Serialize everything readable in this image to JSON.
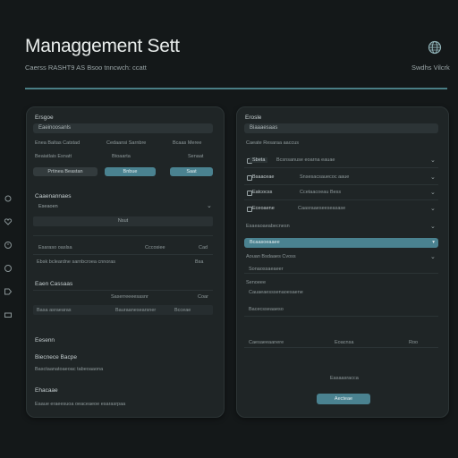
{
  "header": {
    "title": "Managgement Sett",
    "subtitle": "Caerss RASHT9 AS Bsoo tnncwch: ccatt",
    "top_right": "Swdhs Vilcrk"
  },
  "left_panel": {
    "section1": {
      "label": "Ersgoe",
      "field_value": "Eaeinoosanls",
      "col_labels": [
        "Enea Baltas Catstad",
        "Cedaansi Sarnbre",
        "Bcaas Meree"
      ],
      "row_values": [
        "Beaiatlais Esnatt",
        "Btoaarta",
        "Senaat"
      ],
      "buttons": [
        "Prtinea Beastan",
        "Bnbue",
        "Saat"
      ]
    },
    "section2": {
      "label": "Caaenannaes",
      "dropdown_value": "Eseaoen",
      "bar_text": "Nsut",
      "row1_left": "Esaraso oaslsa",
      "row1_mid": "Cccosiee",
      "row1_right": "Cad",
      "row2_left": "Ebsk bcleardne sarnbcroea cnnoras",
      "row2_right": "Bsa"
    },
    "section3": {
      "label": "Eaen Cassaas",
      "row1_mid": "Saserreeeesasnr",
      "row1_right": "Coar",
      "row2_left": "Basa asraearas",
      "row2_mid": "Bauraanesearsner",
      "row2_right": "Bcceae"
    },
    "section4": {
      "label": "Eesenn",
      "sublabel": "Biecnece Bacpe",
      "sublabel_line": "Basctaanatoaeoac tabeoaaona",
      "label2": "Ehacaae",
      "line2": "Eaaue eraeesuoa oeaceaeoe esarasrpaa"
    }
  },
  "right_panel": {
    "label": "Erosle",
    "field_value": "Biaaaesaas",
    "section_header": "Caeate Resaraa aaccus",
    "checkbox_row": {
      "badge": "Sbeta",
      "text": "Bcsnsanuse eoarna eauae"
    },
    "rows": [
      {
        "label": "Bsaaceae",
        "value": "Snsesacsauecoc aaue"
      },
      {
        "label": "Eatcocss",
        "value": "Ccetaacoeau Bess"
      },
      {
        "label": "Eceoaene",
        "value": "Caasraaeseeseasase"
      }
    ],
    "section2_header": "Esaeaoaeabecnesn",
    "highlight": "Bcaasoeaaee",
    "lines": [
      "Aouan Bsdaaes Cvoss",
      "Sonaossaeaeer",
      "Senoeee"
    ],
    "sub_lines": [
      "Cauaeaesssenaoesaene",
      "Bacecsseaaeso"
    ],
    "bottom_row": [
      "Caesaeeaanere",
      "Eoacnsa",
      "Roo"
    ],
    "footer_text": "Easaasracca",
    "footer_button": "Aecteae"
  }
}
